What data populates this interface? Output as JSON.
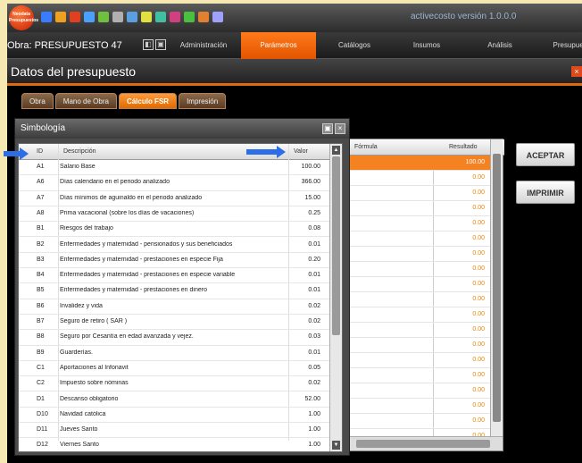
{
  "app": {
    "logo_text": "Neodata Presupuestos",
    "version": "activecosto   versión  1.0.0.0",
    "obra": "Obra: PRESUPUESTO 47",
    "title": "Datos del presupuesto",
    "close": "×"
  },
  "menu": [
    {
      "label": "Administración",
      "active": false
    },
    {
      "label": "Parámetros",
      "active": true
    },
    {
      "label": "Catálogos",
      "active": false
    },
    {
      "label": "Insumos",
      "active": false
    },
    {
      "label": "Análisis",
      "active": false
    },
    {
      "label": "Presupuesto",
      "active": false
    }
  ],
  "tabs": [
    {
      "label": "Obra",
      "active": false
    },
    {
      "label": "Mano de Obra",
      "active": false
    },
    {
      "label": "Cálculo FSR",
      "active": true
    },
    {
      "label": "Impresión",
      "active": false
    }
  ],
  "buttons": {
    "aceptar": "ACEPTAR",
    "imprimir": "IMPRIMIR"
  },
  "background_table": {
    "col_formula": "Fórmula",
    "col_result": "Resultado",
    "results": [
      "100.00",
      "0.00",
      "0.00",
      "0.00",
      "0.00",
      "0.00",
      "0.00",
      "0.00",
      "0.00",
      "0.00",
      "0.00",
      "0.00",
      "0.00",
      "0.00",
      "0.00",
      "0.00",
      "0.00",
      "0.00",
      "0.00"
    ]
  },
  "dialog": {
    "title": "Simbología",
    "col_id": "ID",
    "col_desc": "Descripción",
    "col_val": "Valor",
    "rows": [
      {
        "id": "A1",
        "desc": "Salario Base",
        "val": "100.00"
      },
      {
        "id": "A6",
        "desc": "Días calendario en el periodo analizado",
        "val": "366.00"
      },
      {
        "id": "A7",
        "desc": "Días mínimos de aguinaldo en el periodo analizado",
        "val": "15.00"
      },
      {
        "id": "A8",
        "desc": "Prima vacacional (sobre los días de vacaciones)",
        "val": "0.25"
      },
      {
        "id": "B1",
        "desc": "Riesgos del trabajo",
        "val": "0.08"
      },
      {
        "id": "B2",
        "desc": "Enfermedades y maternidad - pensionados y sus beneficiados",
        "val": "0.01"
      },
      {
        "id": "B3",
        "desc": "Enfermedades y maternidad - prestaciones en especie  Fija",
        "val": "0.20"
      },
      {
        "id": "B4",
        "desc": "Enfermedades y maternidad - prestaciones en especie  variable",
        "val": "0.01"
      },
      {
        "id": "B5",
        "desc": "Enfermedades y maternidad - prestaciones en dinero",
        "val": "0.01"
      },
      {
        "id": "B6",
        "desc": "Invalidez y vida",
        "val": "0.02"
      },
      {
        "id": "B7",
        "desc": "Seguro de retiro ( SAR )",
        "val": "0.02"
      },
      {
        "id": "B8",
        "desc": "Seguro por Cesantía en edad avanzada y vejez.",
        "val": "0.03"
      },
      {
        "id": "B9",
        "desc": "Guarderías.",
        "val": "0.01"
      },
      {
        "id": "C1",
        "desc": "Aportaciones al Infonavit",
        "val": "0.05"
      },
      {
        "id": "C2",
        "desc": "Impuesto sobre nóminas",
        "val": "0.02"
      },
      {
        "id": "D1",
        "desc": "Descanso obligatorio",
        "val": "52.00"
      },
      {
        "id": "D10",
        "desc": "Navidad católica",
        "val": "1.00"
      },
      {
        "id": "D11",
        "desc": "Jueves Santo",
        "val": "1.00"
      },
      {
        "id": "D12",
        "desc": "Viernes Santo",
        "val": "1.00"
      }
    ]
  },
  "colors": {
    "accent": "#f58220",
    "arrow": "#2d6ee8",
    "frame": "#f6e8b2"
  }
}
